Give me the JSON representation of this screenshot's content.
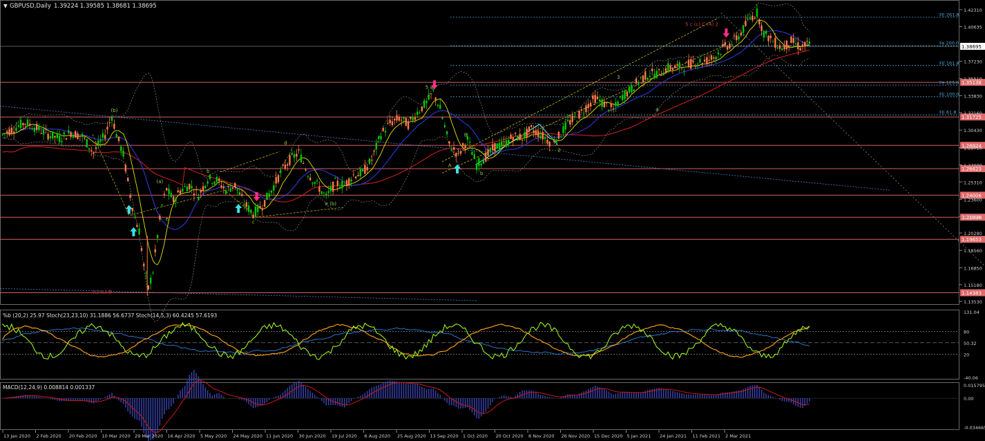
{
  "header": {
    "symbol_label": "GBPUSD,Daily",
    "ohlc": "1.39224 1.39585 1.38681 1.38695",
    "menu_glyph": "▼"
  },
  "colors": {
    "background": "#000000",
    "candle_up": "#00c800",
    "candle_down": "#ff7b4a",
    "ma_red": "#c81e1e",
    "ma_blue": "#2a3bd6",
    "ma_yellow": "#e6e600",
    "level_line": "#d46060",
    "fib_line": "#4fa8d8",
    "stoch_green": "#9cf01e",
    "stoch_orange": "#f39c12",
    "macd_line": "#d01818",
    "macd_hist": "#3a46b8",
    "arrow_up": "#40e0e0",
    "arrow_down": "#ff2d8a",
    "grid": "#444444"
  },
  "chart_data": [
    {
      "type": "candlestick",
      "title": "GBPUSD,Daily",
      "ylim": [
        1.1353,
        1.4231
      ],
      "y_ticks": [
        "1.42310",
        "1.40635",
        "1.38695",
        "1.37230",
        "1.35510",
        "1.33830",
        "1.32160",
        "1.30430",
        "1.28710",
        "1.27000",
        "1.25310",
        "1.23600",
        "1.21880",
        "1.20280",
        "1.18560",
        "1.16850",
        "1.15180",
        "1.13530"
      ],
      "x_ticks": [
        "13 Jan 2020",
        "2 Feb 2020",
        "20 Feb 2020",
        "10 Mar 2020",
        "29 Mar 2020",
        "16 Apr 2020",
        "5 May 2020",
        "24 May 2020",
        "11 Jun 2020",
        "30 Jun 2020",
        "19 Jul 2020",
        "6 Aug 2020",
        "25 Aug 2020",
        "13 Sep 2020",
        "1 Oct 2020",
        "20 Oct 2020",
        "8 Nov 2020",
        "26 Nov 2020",
        "15 Dec 2020",
        "5 Jan 2021",
        "24 Jan 2021",
        "11 Feb 2021",
        "2 Mar 2021"
      ],
      "price_path": [
        [
          0,
          1.3
        ],
        [
          5,
          1.306
        ],
        [
          10,
          1.312
        ],
        [
          15,
          1.306
        ],
        [
          20,
          1.3
        ],
        [
          25,
          1.296
        ],
        [
          30,
          1.302
        ],
        [
          35,
          1.298
        ],
        [
          40,
          1.282
        ],
        [
          45,
          1.3
        ],
        [
          48,
          1.318
        ],
        [
          50,
          1.3
        ],
        [
          53,
          1.28
        ],
        [
          56,
          1.24
        ],
        [
          58,
          1.218
        ],
        [
          60,
          1.205
        ],
        [
          62,
          1.17
        ],
        [
          64,
          1.148
        ],
        [
          66,
          1.165
        ],
        [
          68,
          1.2
        ],
        [
          70,
          1.23
        ],
        [
          72,
          1.246
        ],
        [
          75,
          1.235
        ],
        [
          78,
          1.245
        ],
        [
          82,
          1.25
        ],
        [
          86,
          1.24
        ],
        [
          90,
          1.256
        ],
        [
          94,
          1.255
        ],
        [
          98,
          1.245
        ],
        [
          102,
          1.25
        ],
        [
          106,
          1.232
        ],
        [
          110,
          1.222
        ],
        [
          114,
          1.23
        ],
        [
          118,
          1.245
        ],
        [
          122,
          1.262
        ],
        [
          126,
          1.275
        ],
        [
          130,
          1.282
        ],
        [
          134,
          1.262
        ],
        [
          138,
          1.25
        ],
        [
          142,
          1.238
        ],
        [
          146,
          1.252
        ],
        [
          150,
          1.25
        ],
        [
          154,
          1.26
        ],
        [
          158,
          1.262
        ],
        [
          162,
          1.275
        ],
        [
          166,
          1.3
        ],
        [
          170,
          1.311
        ],
        [
          174,
          1.316
        ],
        [
          178,
          1.31
        ],
        [
          182,
          1.322
        ],
        [
          186,
          1.331
        ],
        [
          189,
          1.342
        ],
        [
          192,
          1.325
        ],
        [
          196,
          1.29
        ],
        [
          200,
          1.28
        ],
        [
          204,
          1.295
        ],
        [
          208,
          1.27
        ],
        [
          212,
          1.278
        ],
        [
          216,
          1.288
        ],
        [
          220,
          1.29
        ],
        [
          224,
          1.298
        ],
        [
          228,
          1.297
        ],
        [
          232,
          1.305
        ],
        [
          236,
          1.3
        ],
        [
          240,
          1.293
        ],
        [
          244,
          1.298
        ],
        [
          248,
          1.311
        ],
        [
          252,
          1.317
        ],
        [
          256,
          1.327
        ],
        [
          260,
          1.336
        ],
        [
          264,
          1.33
        ],
        [
          268,
          1.324
        ],
        [
          272,
          1.338
        ],
        [
          276,
          1.345
        ],
        [
          280,
          1.355
        ],
        [
          284,
          1.36
        ],
        [
          288,
          1.36
        ],
        [
          292,
          1.366
        ],
        [
          296,
          1.366
        ],
        [
          300,
          1.368
        ],
        [
          304,
          1.372
        ],
        [
          308,
          1.372
        ],
        [
          312,
          1.376
        ],
        [
          316,
          1.385
        ],
        [
          320,
          1.39
        ],
        [
          324,
          1.4
        ],
        [
          328,
          1.415
        ],
        [
          331,
          1.42
        ],
        [
          334,
          1.4
        ],
        [
          338,
          1.392
        ],
        [
          342,
          1.385
        ],
        [
          346,
          1.392
        ],
        [
          350,
          1.386
        ],
        [
          354,
          1.389
        ],
        [
          355,
          1.38695
        ]
      ],
      "series": [
        {
          "name": "Moving averages",
          "kind": "lines"
        },
        {
          "name": "Fibonacci extension levels",
          "kind": "horizontal"
        }
      ],
      "horizontal_levels": [
        {
          "value": 1.35138,
          "label": "1.35138"
        },
        {
          "value": 1.31725,
          "label": "1.31725"
        },
        {
          "value": 1.28924,
          "label": "1.28924"
        },
        {
          "value": 1.26623,
          "label": "1.26623"
        },
        {
          "value": 1.24006,
          "label": "1.24006"
        },
        {
          "value": 1.21836,
          "label": "1.21836"
        },
        {
          "value": 1.19653,
          "label": "1.19653"
        },
        {
          "value": 1.14383,
          "label": "1.14383"
        }
      ],
      "fib_levels": [
        {
          "value": 1.4156,
          "label": "FE 261.8"
        },
        {
          "value": 1.3875,
          "label": "Fe 200.0"
        },
        {
          "value": 1.368,
          "label": "FE 161.8"
        },
        {
          "value": 1.3487,
          "label": "Fe 123.6"
        },
        {
          "value": 1.3372,
          "label": "FE 100.0"
        },
        {
          "value": 1.3193,
          "label": "FE 61.8"
        }
      ],
      "annotations": [
        {
          "text": "5 c (c) C (4) 2",
          "t": 300,
          "p": 1.407
        },
        {
          "text": "5 a",
          "t": 186,
          "p": 1.345
        },
        {
          "text": "(b)",
          "t": 48,
          "p": 1.322
        },
        {
          "text": "(a)",
          "t": 68,
          "p": 1.252
        },
        {
          "text": "b",
          "t": 90,
          "p": 1.262
        },
        {
          "text": "d",
          "t": 124,
          "p": 1.29
        },
        {
          "text": "c",
          "t": 110,
          "p": 1.212
        },
        {
          "text": "e (b)",
          "t": 142,
          "p": 1.23
        },
        {
          "text": "e",
          "t": 72,
          "p": 1.215
        },
        {
          "text": "A",
          "t": 196,
          "p": 1.268
        },
        {
          "text": "B",
          "t": 203,
          "p": 1.298
        },
        {
          "text": "b",
          "t": 210,
          "p": 1.26
        },
        {
          "text": "3",
          "t": 270,
          "p": 1.355
        },
        {
          "text": "2",
          "t": 244,
          "p": 1.283
        },
        {
          "text": "4",
          "t": 287,
          "p": 1.323
        },
        {
          "text": "(c) (c) B",
          "t": 40,
          "p": 1.143
        }
      ],
      "arrows_up": [
        56,
        104,
        200,
        58
      ],
      "arrows_down": [
        112,
        190,
        318
      ]
    },
    {
      "type": "line",
      "title": "%b (20,2) 25.97  Stoch(23,23,10) 31.1886 56.6737  Stoch(14,5,3) 60.4245 57.6193",
      "ylim": [
        -40.06,
        131.04
      ],
      "y_ticks": [
        "131.04",
        "80",
        "50.32",
        "20",
        "-40.06"
      ],
      "series": [
        {
          "name": "%b (20,2)",
          "last": 25.97
        },
        {
          "name": "Stoch(23,23,10)",
          "values": [
            31.1886,
            56.6737
          ]
        },
        {
          "name": "Stoch(14,5,3)",
          "values": [
            60.4245,
            57.6193
          ]
        }
      ]
    },
    {
      "type": "bar",
      "title": "MACD(12,24,9) 0.008814 0.001337",
      "ylim": [
        -0.034665,
        0.015795
      ],
      "y_ticks": [
        "0.015795",
        "0.00",
        "-0.034665"
      ],
      "series": [
        {
          "name": "MACD(12,24,9)",
          "values": [
            0.008814,
            0.001337
          ]
        }
      ]
    }
  ]
}
